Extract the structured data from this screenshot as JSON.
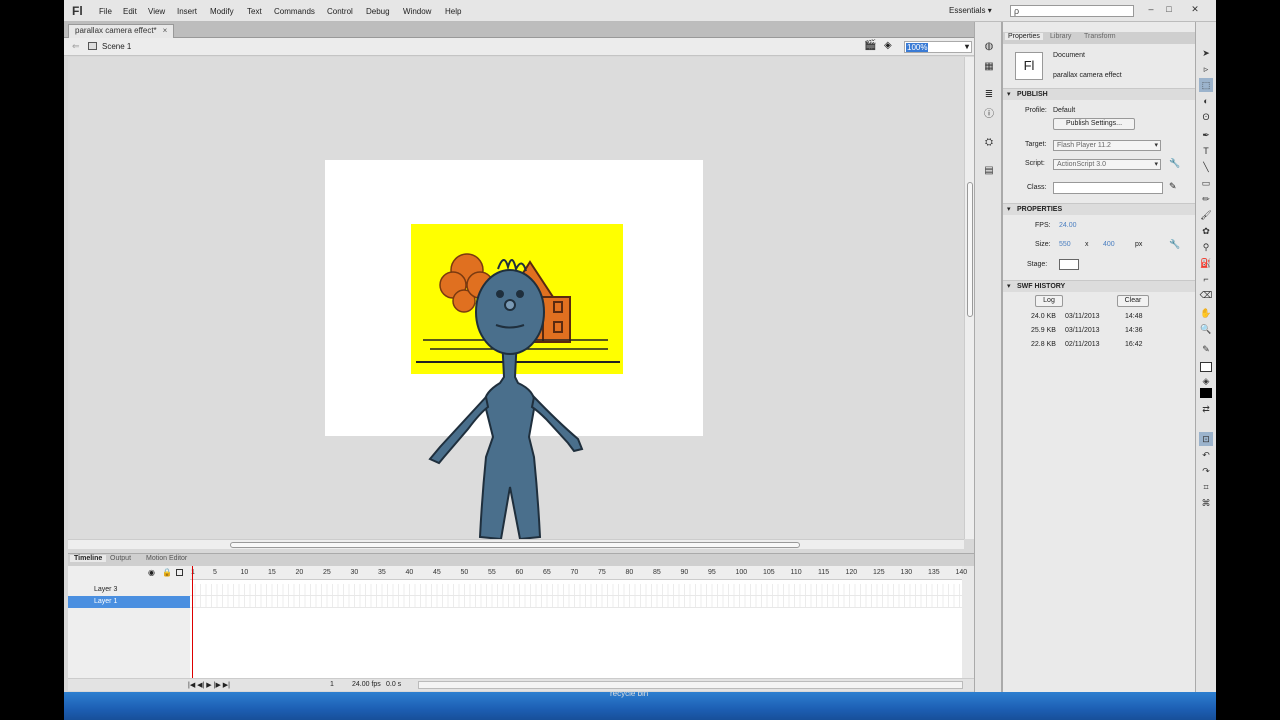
{
  "app": {
    "logo": "Fl"
  },
  "menu": [
    "File",
    "Edit",
    "View",
    "Insert",
    "Modify",
    "Text",
    "Commands",
    "Control",
    "Debug",
    "Window",
    "Help"
  ],
  "workspace": {
    "label": "Essentials",
    "search_placeholder": "ρ"
  },
  "window_buttons": [
    "–",
    "□",
    "✕"
  ],
  "doc_tab": {
    "title": "parallax camera effect*",
    "close": "×"
  },
  "edit_bar": {
    "scene": "Scene 1",
    "zoom": "100%"
  },
  "timeline": {
    "tabs": [
      "Timeline",
      "Output",
      "Motion Editor"
    ],
    "layers": [
      {
        "name": "Layer 3",
        "selected": false
      },
      {
        "name": "Layer 1",
        "selected": true
      }
    ],
    "frame_ticks": [
      "1",
      "5",
      "10",
      "15",
      "20",
      "25",
      "30",
      "35",
      "40",
      "45",
      "50",
      "55",
      "60",
      "65",
      "70",
      "75",
      "80",
      "85",
      "90",
      "95",
      "100",
      "105",
      "110",
      "115",
      "120",
      "125",
      "130",
      "135",
      "140"
    ],
    "status": {
      "frame": "1",
      "fps": "24.00 fps",
      "time": "0.0 s"
    }
  },
  "properties": {
    "tabs": [
      "Properties",
      "Library",
      "Transform"
    ],
    "doc_icon": "Fl",
    "doc_type": "Document",
    "doc_name": "parallax camera effect",
    "publish": {
      "header": "PUBLISH",
      "profile_label": "Profile:",
      "profile_value": "Default",
      "settings_button": "Publish Settings...",
      "target_label": "Target:",
      "target_value": "Flash Player 11.2",
      "script_label": "Script:",
      "script_value": "ActionScript 3.0",
      "class_label": "Class:"
    },
    "props": {
      "header": "PROPERTIES",
      "fps_label": "FPS:",
      "fps_value": "24.00",
      "size_label": "Size:",
      "width": "550",
      "x": "x",
      "height": "400",
      "unit": "px",
      "stage_label": "Stage:",
      "stage_color": "#ffffff"
    },
    "swf_history": {
      "header": "SWF HISTORY",
      "log_button": "Log",
      "clear_button": "Clear",
      "entries": [
        {
          "size": "24.0 KB",
          "date": "03/11/2013",
          "time": "14:48"
        },
        {
          "size": "25.9 KB",
          "date": "03/11/2013",
          "time": "14:36"
        },
        {
          "size": "22.8 KB",
          "date": "02/11/2013",
          "time": "16:42"
        }
      ]
    }
  },
  "taskbar": {
    "recycle": "recycle bin"
  }
}
